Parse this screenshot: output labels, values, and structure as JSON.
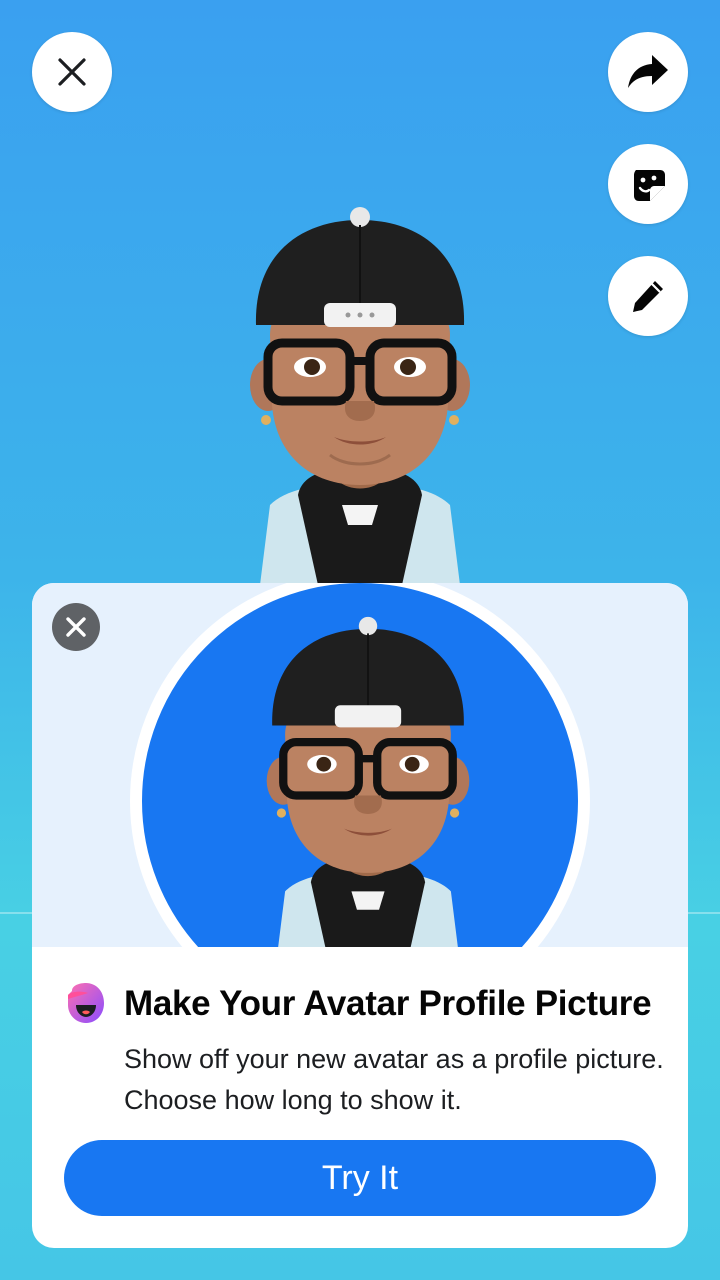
{
  "top_actions": {
    "close_icon": "close-icon",
    "share_icon": "share-arrow-icon",
    "sticker_icon": "avatar-sticker-icon",
    "edit_icon": "pencil-icon"
  },
  "promo_card": {
    "dismiss_icon": "close-icon",
    "app_icon": "avatar-app-icon",
    "title": "Make Your Avatar Profile Picture",
    "description": "Show off your new avatar as a profile picture. Choose how long to show it.",
    "cta_label": "Try It",
    "accent_color": "#1877f2"
  },
  "colors": {
    "background_top": "#3aa0f0",
    "background_bottom": "#48d0e4",
    "preview_circle": "#1877f2",
    "card_top": "#e6f1fd"
  }
}
